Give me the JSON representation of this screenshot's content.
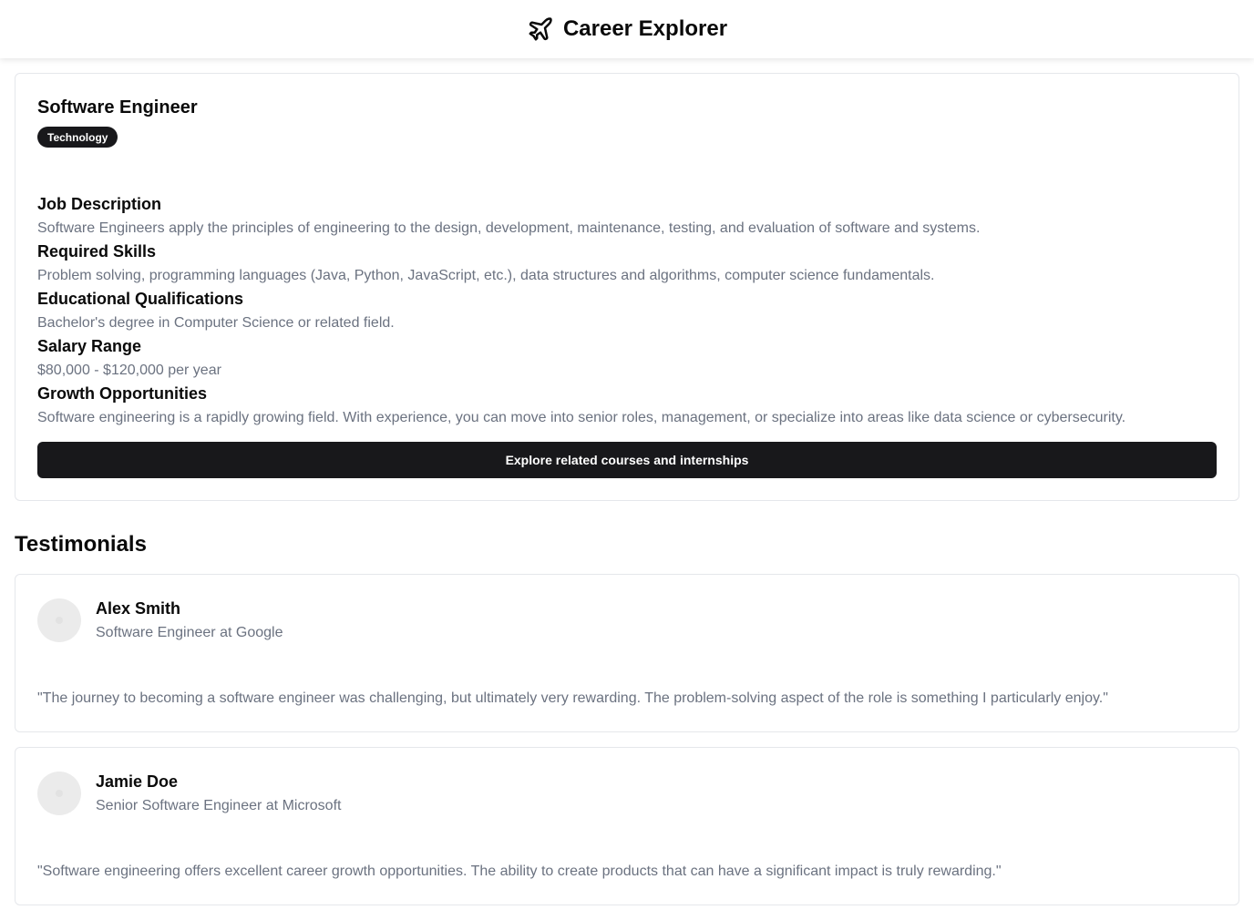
{
  "header": {
    "title": "Career Explorer",
    "icon": "plane-icon"
  },
  "career": {
    "title": "Software Engineer",
    "category": "Technology",
    "sections": [
      {
        "heading": "Job Description",
        "body": "Software Engineers apply the principles of engineering to the design, development, maintenance, testing, and evaluation of software and systems."
      },
      {
        "heading": "Required Skills",
        "body": "Problem solving, programming languages (Java, Python, JavaScript, etc.), data structures and algorithms, computer science fundamentals."
      },
      {
        "heading": "Educational Qualifications",
        "body": "Bachelor's degree in Computer Science or related field."
      },
      {
        "heading": "Salary Range",
        "body": "$80,000 - $120,000 per year"
      },
      {
        "heading": "Growth Opportunities",
        "body": "Software engineering is a rapidly growing field. With experience, you can move into senior roles, management, or specialize into areas like data science or cybersecurity."
      }
    ],
    "cta_label": "Explore related courses and internships"
  },
  "testimonials": {
    "heading": "Testimonials",
    "items": [
      {
        "name": "Alex Smith",
        "role": "Software Engineer at Google",
        "quote": "\"The journey to becoming a software engineer was challenging, but ultimately very rewarding. The problem-solving aspect of the role is something I particularly enjoy.\""
      },
      {
        "name": "Jamie Doe",
        "role": "Senior Software Engineer at Microsoft",
        "quote": "\"Software engineering offers excellent career growth opportunities. The ability to create products that can have a significant impact is truly rewarding.\""
      }
    ]
  },
  "colors": {
    "primary": "#18181b",
    "muted_text": "#6b7280",
    "border": "#e5e7eb",
    "avatar_placeholder": "#ebebeb"
  }
}
